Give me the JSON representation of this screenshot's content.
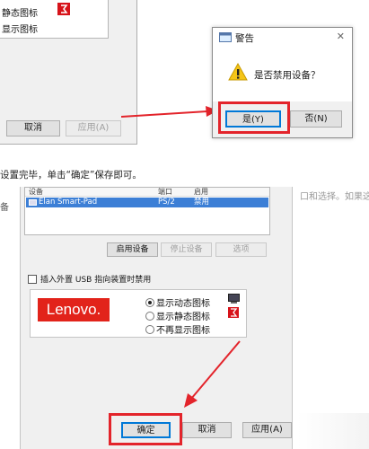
{
  "top_dialog": {
    "row1_label": "静态图标",
    "row2_label": "显示图标",
    "cancel_label": "取消",
    "apply_label": "应用(A)"
  },
  "warning_dialog": {
    "title": "警告",
    "close_symbol": "✕",
    "message": "是否禁用设备？",
    "yes_label": "是(Y)",
    "no_label": "否(N)"
  },
  "caption": {
    "text": "设置完毕，单击“确定”保存即可。",
    "right_edge_text": "口和选择。如果这个"
  },
  "device_dialog": {
    "left_edge_text": "备",
    "columns": [
      "设备",
      "端口",
      "启用"
    ],
    "rows": [
      {
        "device": "Elan Smart-Pad",
        "port": "PS/2",
        "enabled": "禁用"
      }
    ],
    "enable_button": "启用设备",
    "stop_button": "停止设备",
    "options_button": "选项",
    "usb_checkbox_label": "插入外置 USB 指向装置时禁用",
    "logo_text": "Lenovo.",
    "radio_options": [
      "显示动态图标",
      "显示静态图标",
      "不再显示图标"
    ],
    "selected_radio": "显示动态图标",
    "ok_label": "确定",
    "cancel_label": "取消",
    "apply_label": "应用(A)"
  },
  "colors": {
    "highlight_red": "#e3242b",
    "selection_blue": "#3c7fd6",
    "lenovo_red": "#e2231a"
  }
}
